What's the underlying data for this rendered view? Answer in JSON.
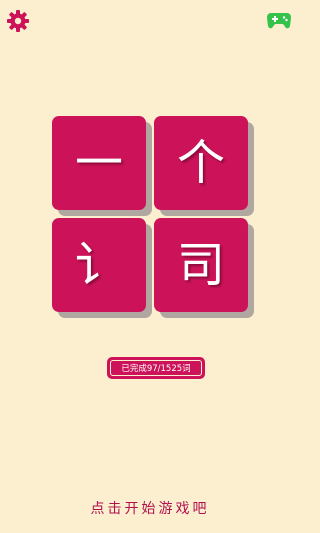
{
  "icons": {
    "settings": "gear-icon",
    "game_center": "gamepad-icon"
  },
  "colors": {
    "background": "#fcefcf",
    "tile": "#cc1359",
    "tile_shadow": "#b0a8a0",
    "gamepad": "#35c24b",
    "text_accent": "#b00f4c"
  },
  "tiles": [
    "一",
    "个",
    "讠",
    "司"
  ],
  "progress": {
    "label": "已完成97/1525词"
  },
  "start": {
    "label": "点击开始游戏吧"
  }
}
